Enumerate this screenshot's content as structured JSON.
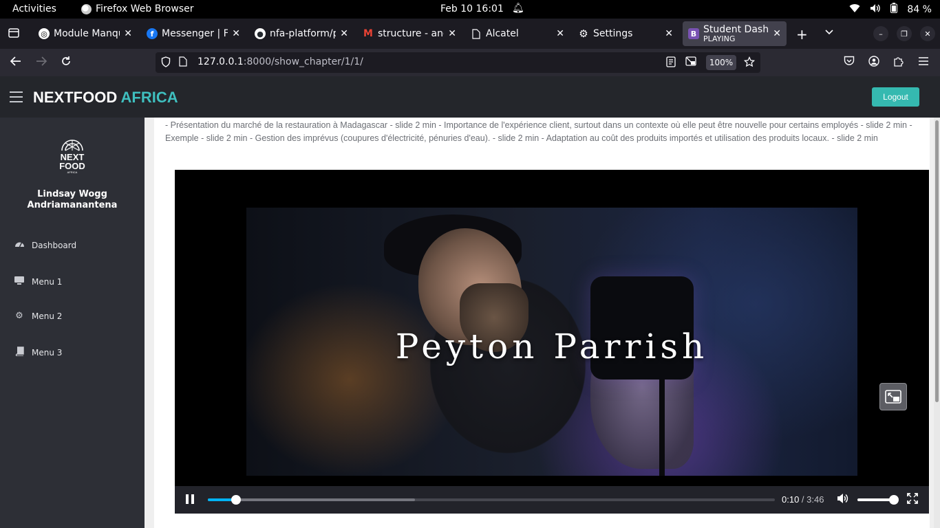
{
  "system_bar": {
    "activities": "Activities",
    "app_name": "Firefox Web Browser",
    "clock": "Feb 10  16:01",
    "battery": "84 %"
  },
  "tabs": [
    {
      "title": "Module Manqu",
      "icon": "chatgpt-icon",
      "color": "#2a2a2a"
    },
    {
      "title": "Messenger | Fa",
      "icon": "facebook-icon",
      "color": "#1877f2"
    },
    {
      "title": "nfa-platform/p",
      "icon": "github-icon",
      "color": "#24292f"
    },
    {
      "title": "structure - and",
      "icon": "gmail-icon",
      "color": "#ea4335"
    },
    {
      "title": "Alcatel",
      "icon": "page-icon",
      "color": "#6e6d75"
    },
    {
      "title": "Settings",
      "icon": "gear-icon",
      "color": "#6e6d75"
    },
    {
      "title": "Student Dashb",
      "subtitle": "PLAYING",
      "icon": "bootstrap-icon",
      "color": "#7952b3"
    }
  ],
  "navbar": {
    "url_host": "127.0.0.1",
    "url_path": ":8000/show_chapter/1/1/",
    "zoom": "100%"
  },
  "app": {
    "brand_main": "NEXTFOOD",
    "brand_accent": "AFRICA",
    "logout_label": "Logout",
    "accent_color": "#35b9b0"
  },
  "sidebar": {
    "logo_text_top": "NEXT",
    "logo_text_bottom": "FOOD",
    "logo_small": "AFRICA",
    "user_name_line1": "Lindsay Wogg",
    "user_name_line2": "Andriamanantena",
    "items": [
      {
        "label": "Dashboard",
        "icon": "dashboard-icon"
      },
      {
        "label": "Menu 1",
        "icon": "monitor-icon"
      },
      {
        "label": "Menu 2",
        "icon": "cogs-icon"
      },
      {
        "label": "Menu 3",
        "icon": "book-icon"
      }
    ]
  },
  "content": {
    "description": "- Présentation du marché de la restauration à Madagascar - slide 2 min - Importance de l'expérience client, surtout dans un contexte où elle peut être nouvelle pour certains employés - slide 2 min - Exemple - slide 2 min - Gestion des imprévus (coupures d'électricité, pénuries d'eau). - slide 2 min - Adaptation au coût des produits importés et utilisation des produits locaux. - slide 2 min"
  },
  "video": {
    "caption": "Peyton Parrish",
    "current_time": "0:10",
    "duration": "3:46",
    "played_fraction": 0.05,
    "buffered_fraction": 0.365,
    "volume_fraction": 0.92
  }
}
